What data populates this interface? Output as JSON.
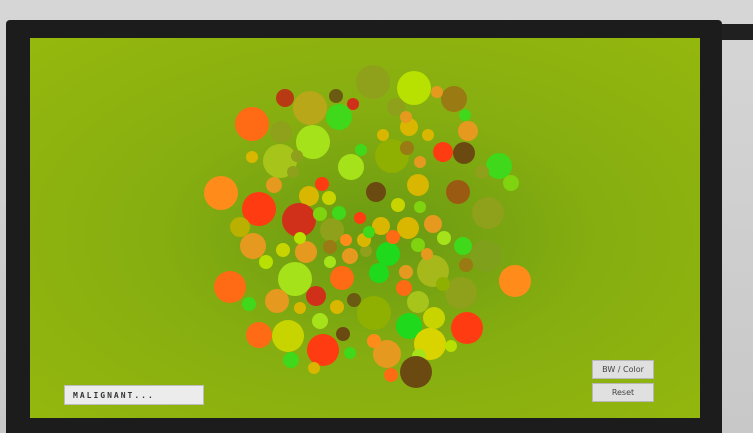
{
  "status": {
    "label": "MALIGNANT..."
  },
  "controls": {
    "bw_color_label": "BW / Color",
    "reset_label": "Reset"
  },
  "colors": {
    "background": "#8fb40f",
    "palette": [
      "#ff3b12",
      "#ff6a14",
      "#ff8c1a",
      "#e59a1f",
      "#d9b600",
      "#c8d400",
      "#b8e000",
      "#a6e21a",
      "#7fd40f",
      "#3fd81a",
      "#1fd91c",
      "#8fa01a",
      "#6b5a12",
      "#6b4a12",
      "#9a7a12"
    ]
  }
}
